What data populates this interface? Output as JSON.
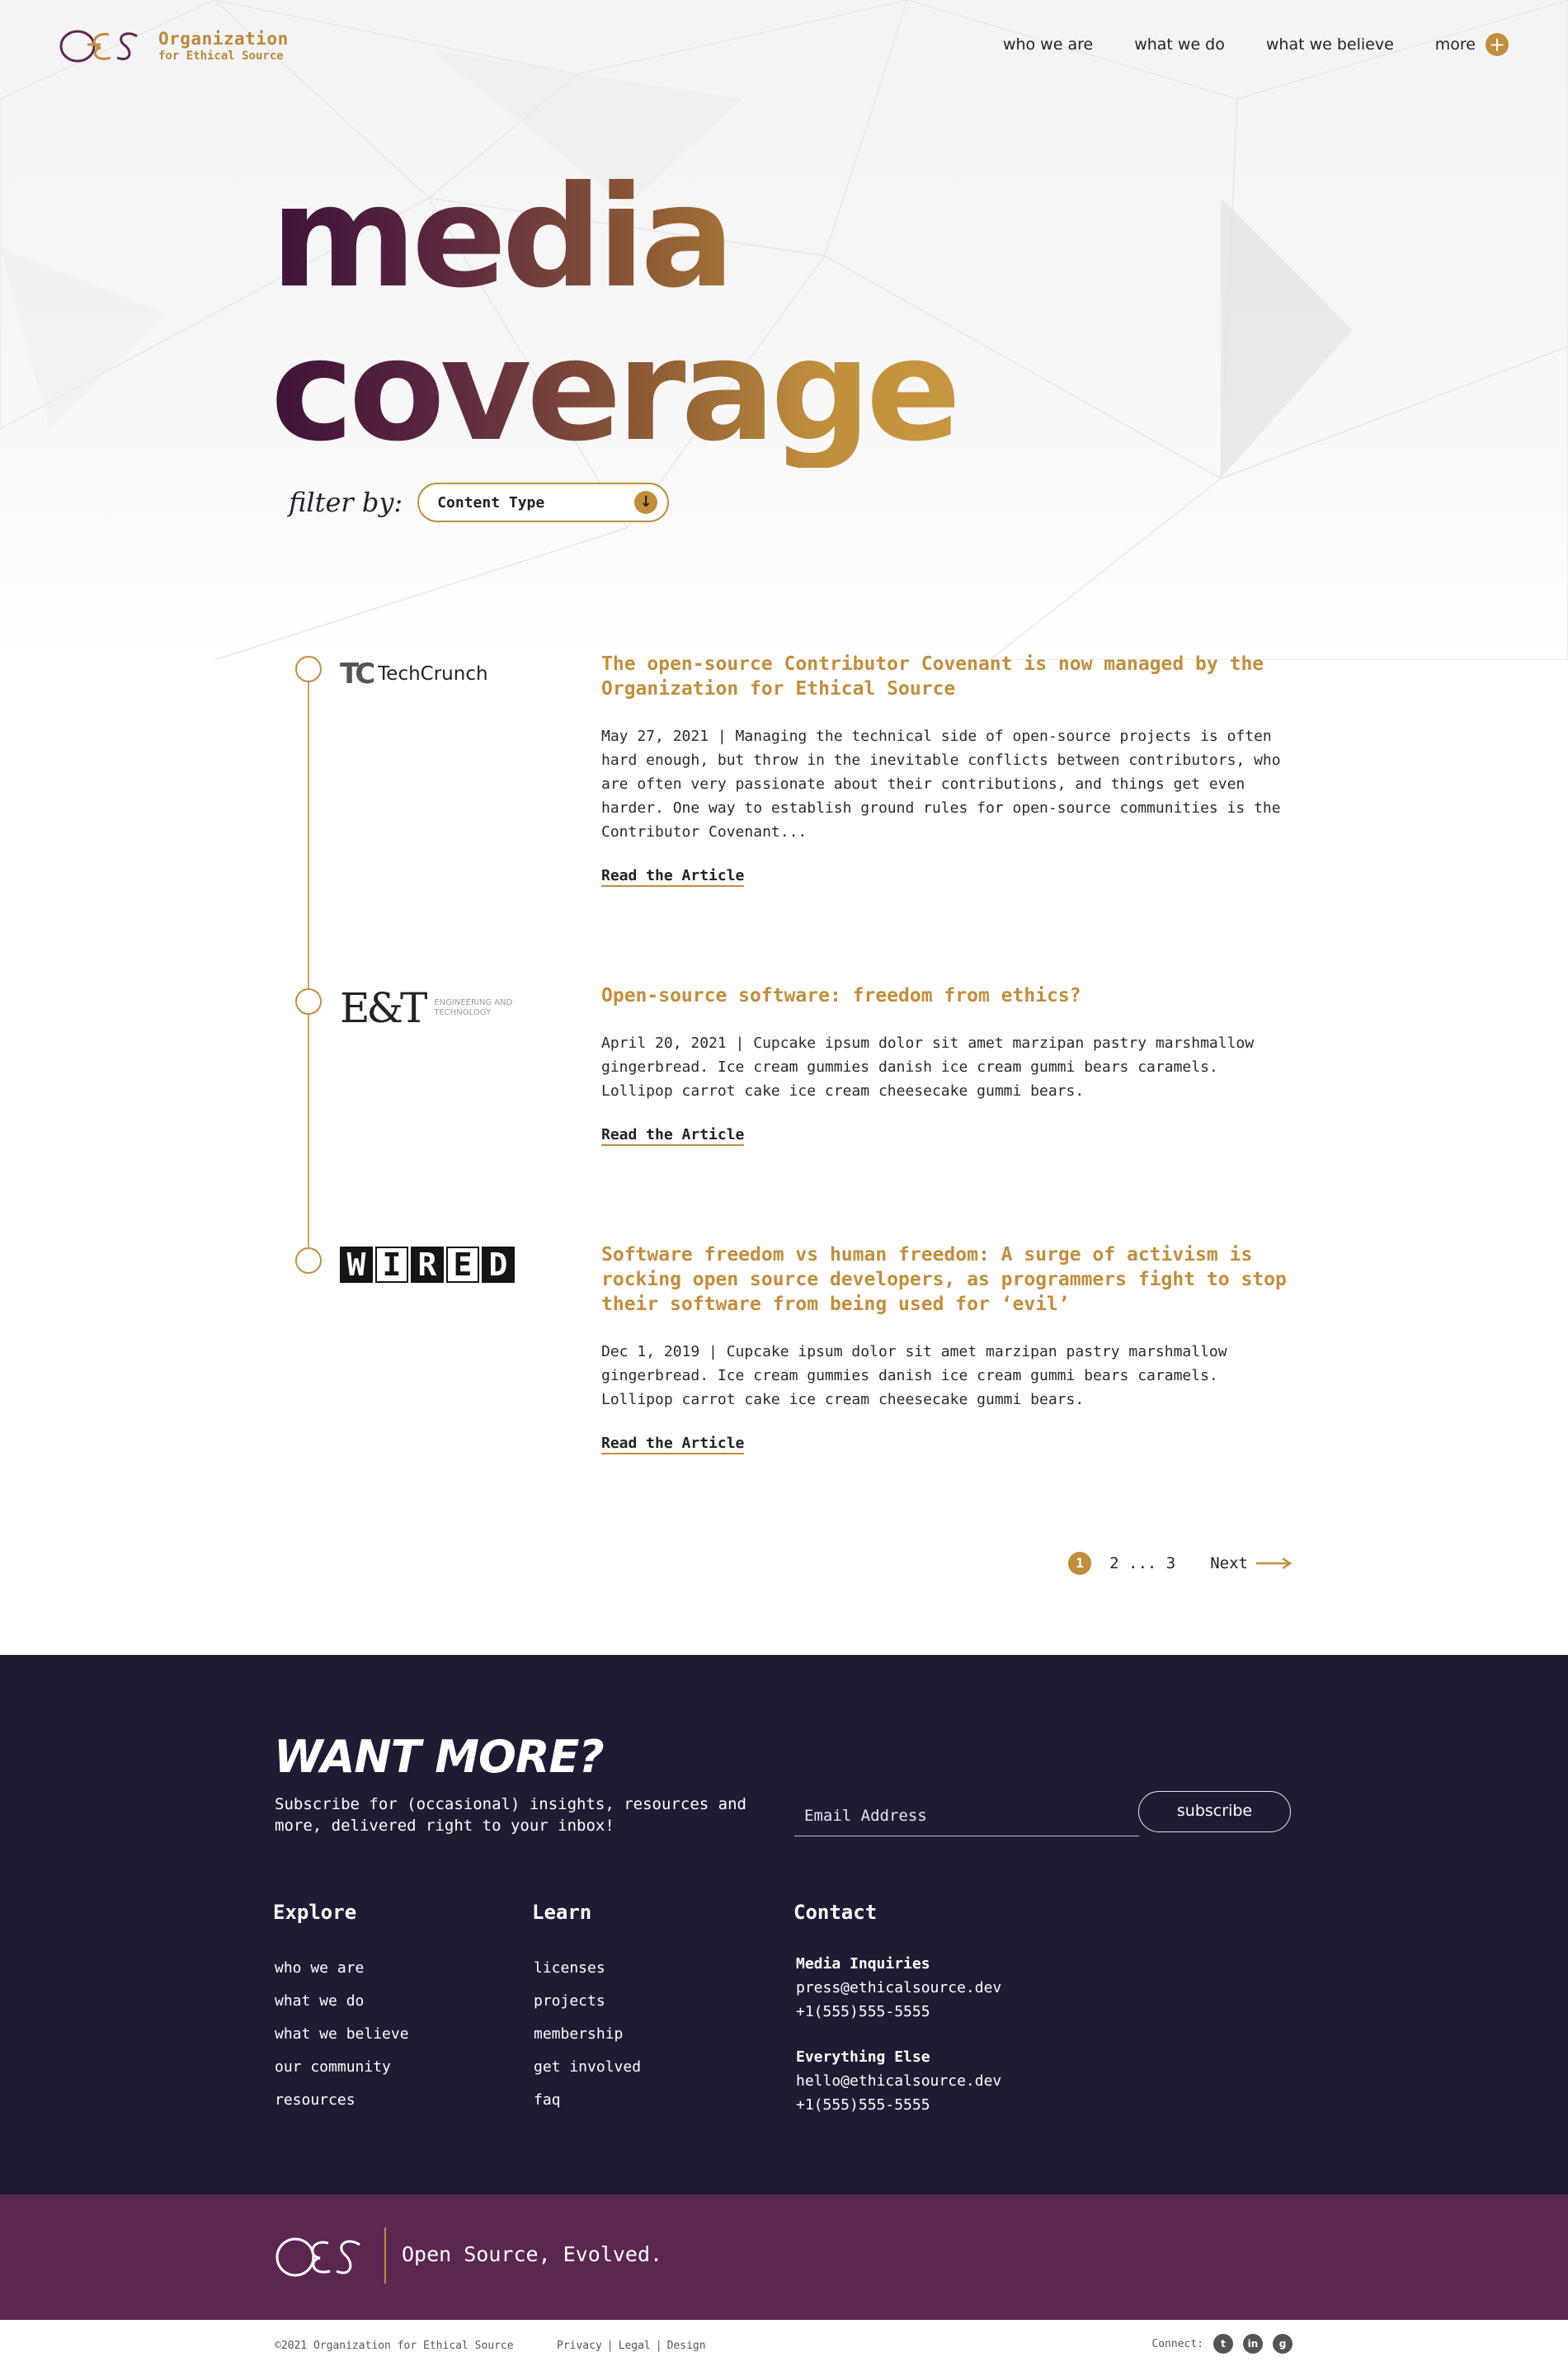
{
  "header": {
    "logo_line1": "Organization",
    "logo_line2": "for Ethical Source",
    "nav": [
      "who we are",
      "what we do",
      "what we believe",
      "more"
    ]
  },
  "hero": {
    "title_line1": "media",
    "title_line2": "coverage",
    "filter_label": "filter by:",
    "filter_value": "Content Type"
  },
  "articles": [
    {
      "publication": "TechCrunch",
      "title": "The open-source Contributor Covenant is now managed by the Organization for Ethical Source",
      "body": "May 27, 2021 | Managing the technical side of open-source projects is often hard enough, but throw in the inevitable conflicts between contributors, who are often very passionate about their contributions, and things get even harder. One way to establish ground rules for open-source communities is the Contributor Covenant...",
      "link": "Read the Article"
    },
    {
      "publication": "E&T",
      "publication_sub": "ENGINEERING AND TECHNOLOGY",
      "title": "Open-source software: freedom from ethics?",
      "body": "April 20, 2021 | Cupcake ipsum dolor sit amet marzipan pastry marshmallow gingerbread. Ice cream gummies danish ice cream gummi bears caramels. Lollipop carrot cake ice cream cheesecake gummi bears.",
      "link": "Read the Article"
    },
    {
      "publication": "WIRED",
      "title": "Software freedom vs human freedom: A surge of activism is rocking open source developers, as programmers fight to stop their software from being used for ‘evil’",
      "body": "Dec 1, 2019 | Cupcake ipsum dolor sit amet marzipan pastry marshmallow gingerbread. Ice cream gummies danish ice cream gummi bears caramels. Lollipop carrot cake ice cream cheesecake gummi bears.",
      "link": "Read the Article"
    }
  ],
  "pagination": {
    "current": "1",
    "pages": "2 ... 3",
    "next": "Next"
  },
  "footer": {
    "want_more": "WANT MORE?",
    "subscribe_text": "Subscribe for (occasional) insights, resources and more, delivered right to your inbox!",
    "email_placeholder": "Email Address",
    "subscribe_button": "subscribe",
    "explore": {
      "heading": "Explore",
      "links": [
        "who we are",
        "what we do",
        "what we believe",
        "our community",
        "resources"
      ]
    },
    "learn": {
      "heading": "Learn",
      "links": [
        "licenses",
        "projects",
        "membership",
        "get involved",
        "faq"
      ]
    },
    "contact": {
      "heading": "Contact",
      "media_title": "Media Inquiries",
      "media_email": "press@ethicalsource.dev",
      "media_phone": "+1(555)555-5555",
      "else_title": "Everything Else",
      "else_email": "hello@ethicalsource.dev",
      "else_phone": "+1(555)555-5555"
    },
    "tagline": "Open Source, Evolved.",
    "copyright": "©2021 Organization for Ethical Source",
    "legal_links": [
      "Privacy",
      "Legal",
      "Design"
    ],
    "connect_label": "Connect:"
  },
  "colors": {
    "accent_gold": "#c08e3c",
    "footer_navy": "#1f1b33",
    "brand_purple": "#5b2750",
    "title_dark": "#3f1238"
  },
  "icons": {
    "more": "plus-circle-icon",
    "filter_dropdown": "arrow-down-circle-icon",
    "next": "arrow-right-icon",
    "social": [
      "twitter-icon",
      "linkedin-icon",
      "github-icon"
    ]
  }
}
